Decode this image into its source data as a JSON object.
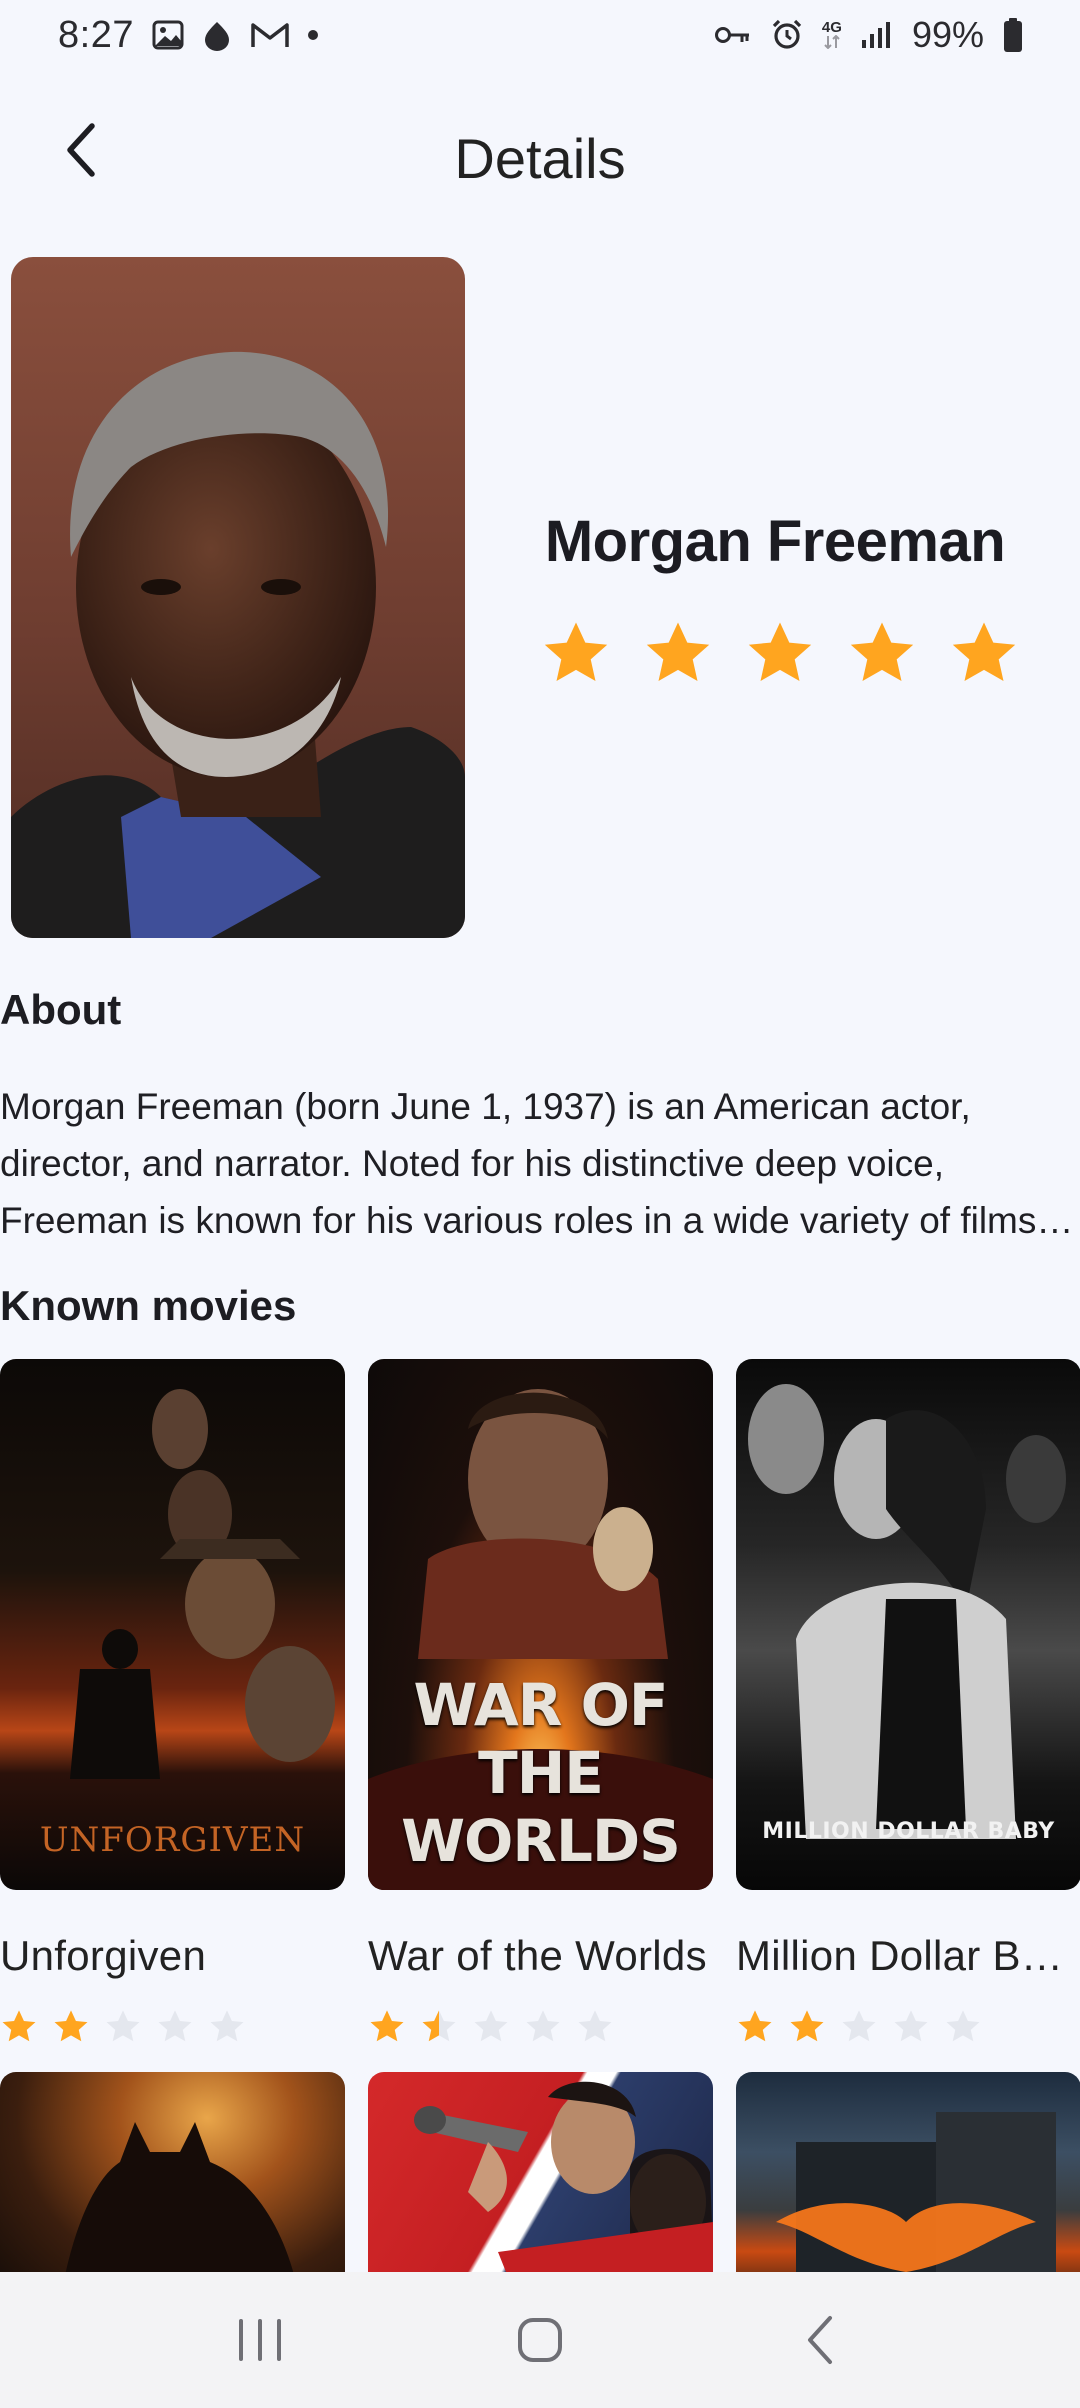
{
  "status_bar": {
    "time": "8:27",
    "battery": "99%",
    "network": "4G"
  },
  "header": {
    "title": "Details"
  },
  "profile": {
    "name": "Morgan Freeman",
    "rating_of_5": 5
  },
  "about": {
    "title": "About",
    "text": "Morgan Freeman (born June 1, 1937) is an American actor, director, and narrator. Noted for his distinctive deep voice, Freeman is known for his various roles in a wide variety of films and television shows."
  },
  "known_movies": {
    "title": "Known movies",
    "items": [
      {
        "title": "Unforgiven",
        "rating_of_5": 2,
        "poster_caption": "UNFORGIVEN"
      },
      {
        "title": "War of the Worlds",
        "rating_of_5": 1.5,
        "poster_caption": "WAR OF THE WORLDS"
      },
      {
        "title": "Million Dollar Baby",
        "rating_of_5": 2,
        "poster_caption": "MILLION DOLLAR BABY"
      }
    ]
  },
  "colors": {
    "star_filled": "#ffa51f",
    "star_empty": "#e4e7ee",
    "background": "#f5f7fd"
  }
}
